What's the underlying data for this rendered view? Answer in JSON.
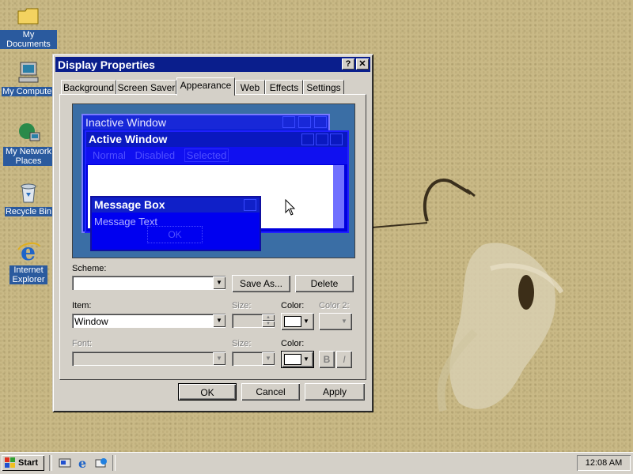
{
  "desktop": {
    "icons": [
      {
        "label": "My Documents"
      },
      {
        "label": "My Computer"
      },
      {
        "label": "My Network Places"
      },
      {
        "label": "Recycle Bin"
      },
      {
        "label": "Internet Explorer"
      }
    ]
  },
  "dialog": {
    "title": "Display Properties",
    "help_glyph": "?",
    "close_glyph": "✕",
    "tabs": [
      {
        "label": "Background"
      },
      {
        "label": "Screen Saver"
      },
      {
        "label": "Appearance",
        "active": true
      },
      {
        "label": "Web"
      },
      {
        "label": "Effects"
      },
      {
        "label": "Settings"
      }
    ],
    "preview": {
      "inactive_title": "Inactive Window",
      "active_title": "Active Window",
      "menu_normal": "Normal",
      "menu_disabled": "Disabled",
      "menu_selected": "Selected",
      "msgbox_title": "Message Box",
      "msgbox_text": "Message Text",
      "msgbox_ok": "OK"
    },
    "scheme": {
      "label": "Scheme:",
      "value": "",
      "save_as": "Save As...",
      "delete": "Delete"
    },
    "item": {
      "label": "Item:",
      "value": "Window",
      "size_label": "Size:",
      "color_label": "Color:",
      "color2_label": "Color 2:"
    },
    "font": {
      "label": "Font:",
      "size_label": "Size:",
      "color_label": "Color:",
      "bold": "B",
      "italic": "I"
    },
    "buttons": {
      "ok": "OK",
      "cancel": "Cancel",
      "apply": "Apply"
    }
  },
  "taskbar": {
    "start_label": "Start",
    "clock": "12:08 AM"
  },
  "colors": {
    "title_active": "#0a1e8c",
    "preview_bg": "#3a6ea5",
    "wallpaper": "#c9b986",
    "chrome": "#d4d0c8"
  }
}
